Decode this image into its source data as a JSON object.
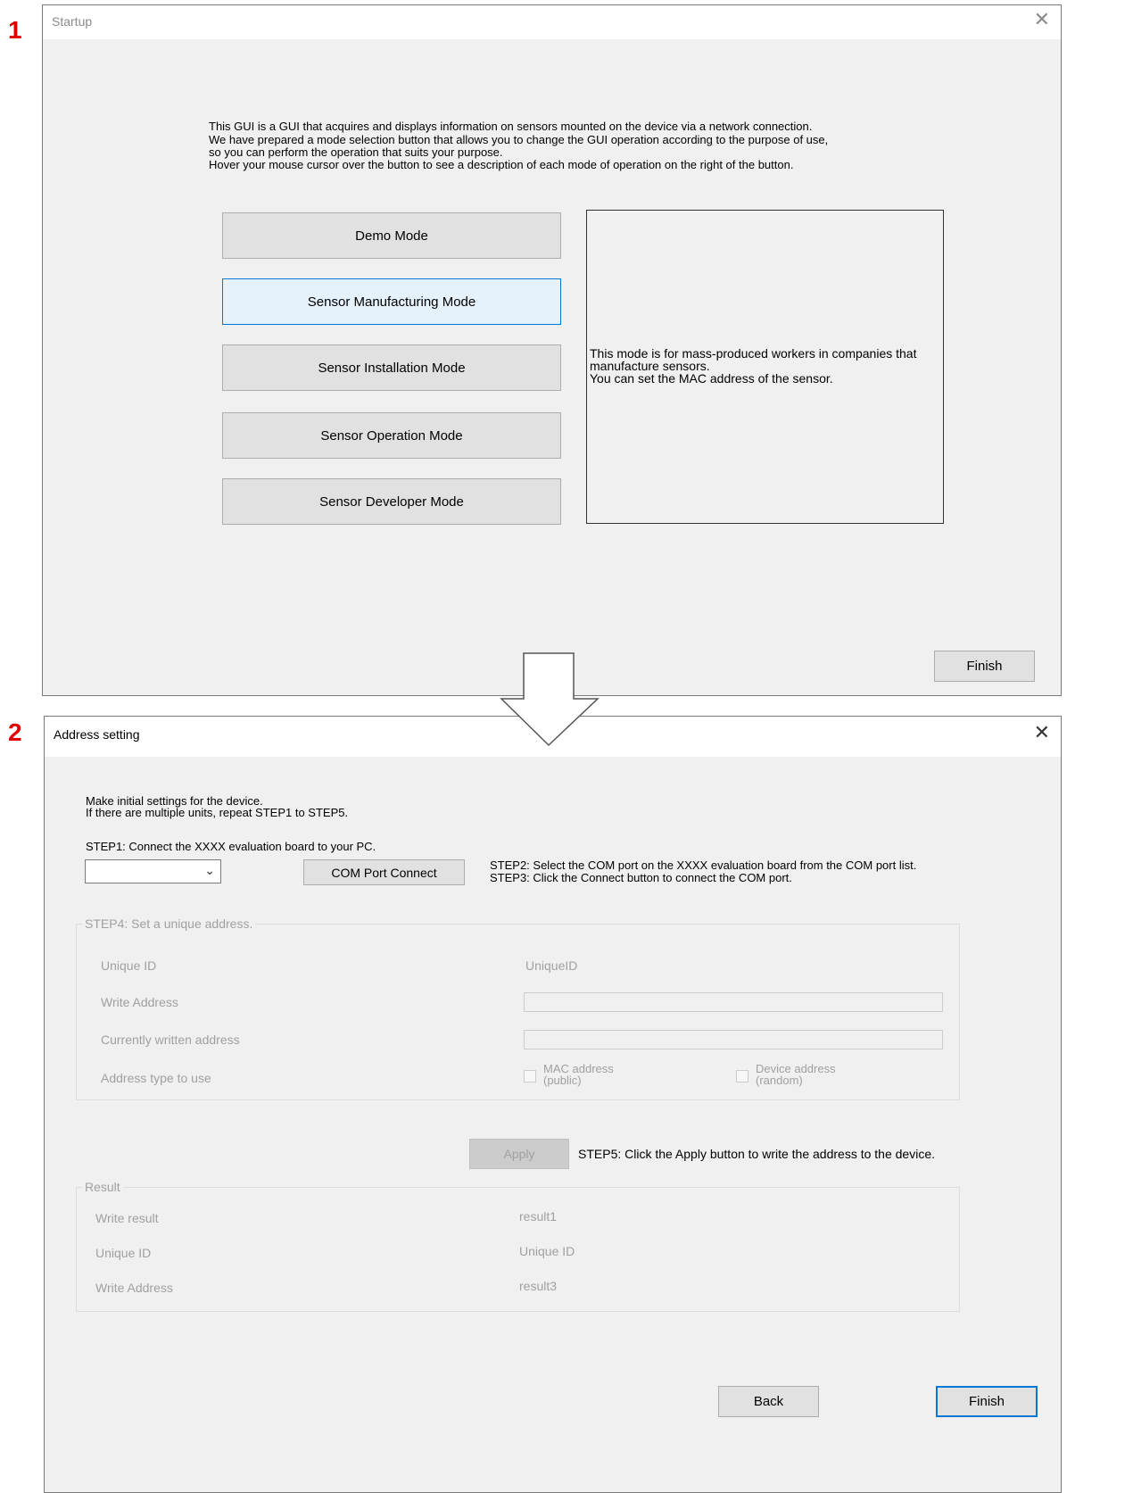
{
  "step_labels": [
    "1",
    "2"
  ],
  "startup": {
    "title": "Startup",
    "intro_lines": [
      "This GUI is a GUI that acquires and displays information on sensors mounted on the device via a network connection.",
      "We have prepared a mode selection button that allows you to change the GUI operation according to the purpose of use,",
      "so you can perform the operation that suits your purpose.",
      "Hover your mouse cursor over the button to see a description of each mode of operation on the right of the button."
    ],
    "modes": [
      "Demo Mode",
      "Sensor Manufacturing Mode",
      "Sensor Installation Mode",
      "Sensor Operation Mode",
      "Sensor Developer Mode"
    ],
    "hovered_mode": "Sensor Manufacturing Mode",
    "description": "This mode is for mass-produced workers in companies that\nmanufacture sensors.\nYou can set the MAC address of the sensor.",
    "finish_label": "Finish"
  },
  "address": {
    "title": "Address setting",
    "intro_lines": [
      "Make initial settings for the device.",
      "If there are multiple units, repeat STEP1 to STEP5."
    ],
    "step1": "STEP1: Connect the XXXX evaluation board to your PC.",
    "com_port_value": "",
    "com_connect_label": "COM Port Connect",
    "step2": "STEP2: Select the COM port on the XXXX evaluation board from the COM port list.",
    "step3": "STEP3: Click the Connect button to connect the COM port.",
    "step4_group": {
      "title": "STEP4: Set a unique address.",
      "unique_id_label": "Unique ID",
      "unique_id_value": "UniqueID",
      "write_address_label": "Write Address",
      "write_address_value": "",
      "current_address_label": "Currently written address",
      "current_address_value": "",
      "address_type_label": "Address type to use",
      "mac_option": "MAC address\n(public)",
      "device_option": "Device address\n(random)"
    },
    "apply_label": "Apply",
    "step5": "STEP5: Click the Apply button to write the address to the device.",
    "result_group": {
      "title": "Result",
      "write_result_label": "Write result",
      "write_result_value": "result1",
      "unique_id_label": "Unique ID",
      "unique_id_value": "Unique ID",
      "write_address_label": "Write Address",
      "write_address_value": "result3"
    },
    "back_label": "Back",
    "finish_label": "Finish"
  }
}
